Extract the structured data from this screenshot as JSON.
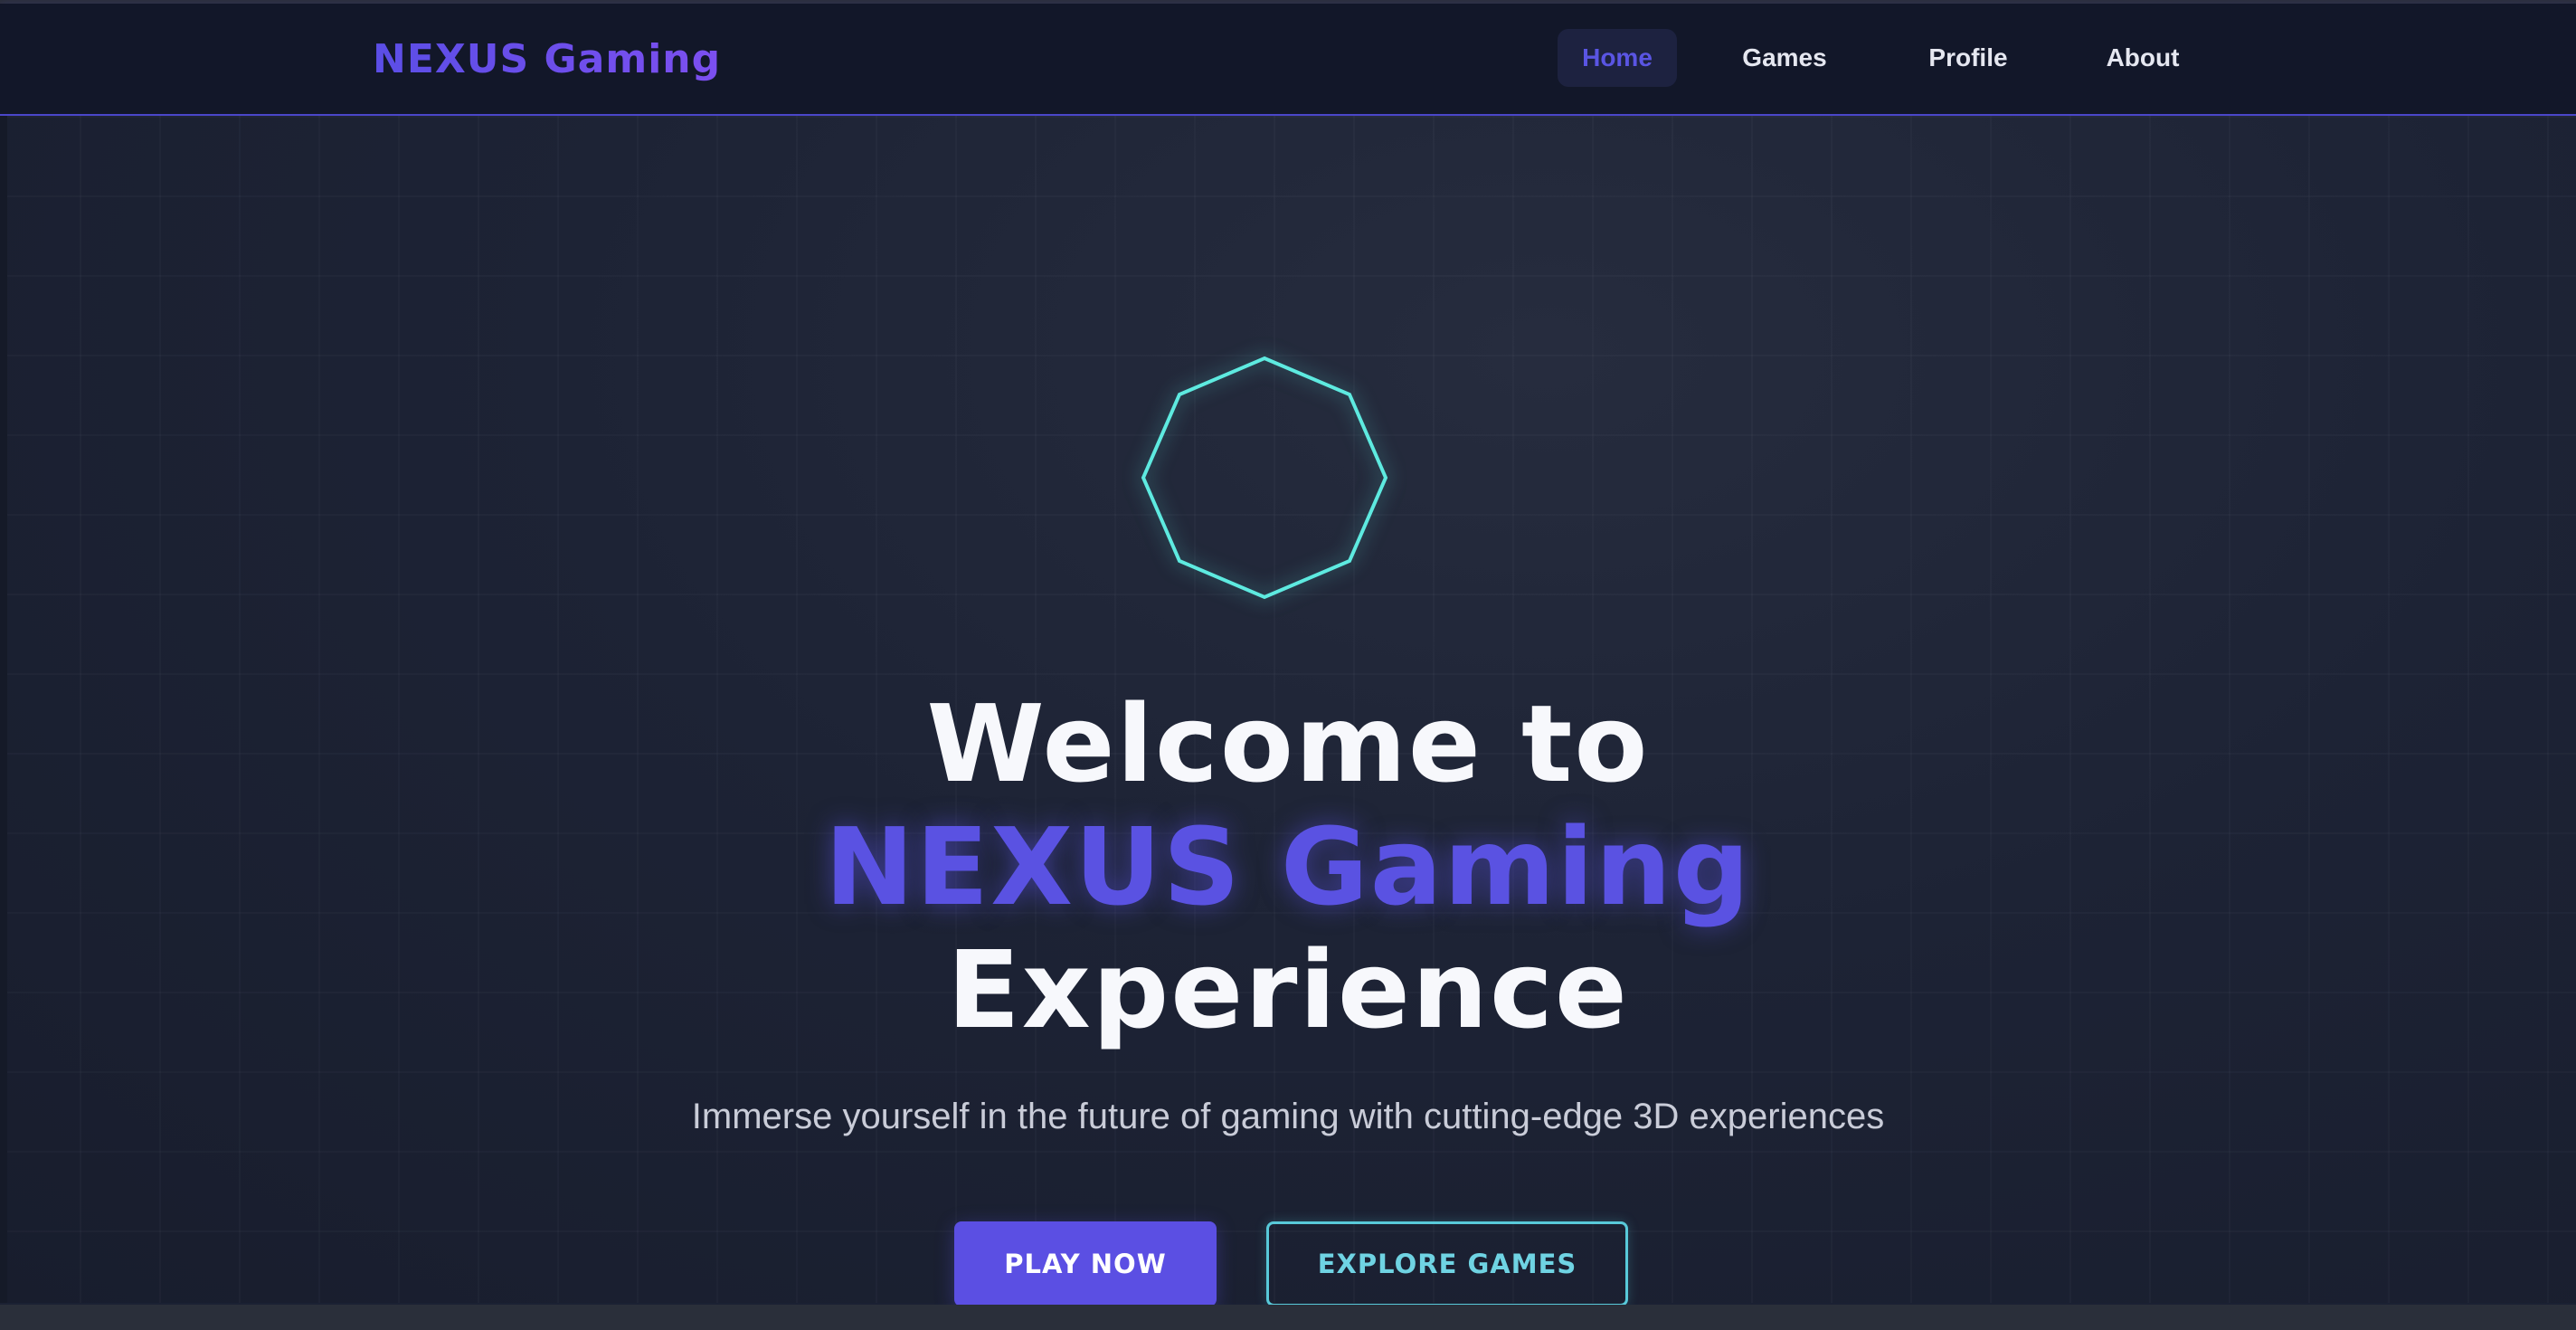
{
  "brand": {
    "name": "NEXUS Gaming",
    "accent_color": "#5b4fe3",
    "cyan_color": "#5eeae0"
  },
  "nav": {
    "items": [
      {
        "label": "Home",
        "active": true
      },
      {
        "label": "Games",
        "active": false
      },
      {
        "label": "Profile",
        "active": false
      },
      {
        "label": "About",
        "active": false
      }
    ]
  },
  "hero": {
    "icon": "octagon-icon",
    "line1": "Welcome to",
    "line2": "NEXUS Gaming",
    "line3": "Experience",
    "subtitle": "Immerse yourself in the future of gaming with cutting-edge 3D experiences",
    "primary_button": "PLAY NOW",
    "secondary_button": "EXPLORE GAMES"
  }
}
